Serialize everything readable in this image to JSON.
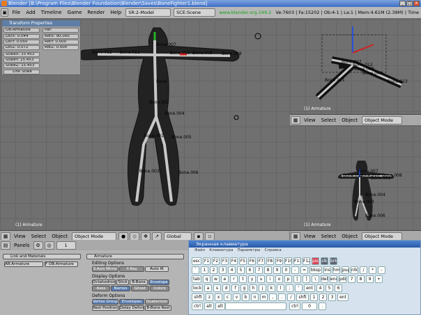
{
  "titlebar": {
    "title": "Blender [B:\\Program Files\\Blender Foundation\\Blender\\Saves\\BoneFighter1.blend]"
  },
  "menubar": {
    "menus": [
      "File",
      "Add",
      "Timeline",
      "Game",
      "Render",
      "Help"
    ],
    "screen": "SR:2-Model",
    "scene": "SCE:Scene",
    "website": "www.blender.org 249.2",
    "stats": "Ve:7603 | Fa:15202 | Ob:4-1 | La:1 | Mem:4.61M (2.39M) | Time"
  },
  "transform": {
    "title": "Transform Properties",
    "ob": "OB:Armature",
    "par": "Par:",
    "locx": "LocX: 0.044",
    "locy": "LocY: 0.050",
    "locz": "LocZ: 0.072",
    "rotx": "RotX: 90.000",
    "roty": "RotY: 0.000",
    "rotz": "RotZ: 0.000",
    "scalex": "ScaleX: 15.453",
    "scaley": "ScaleY: 15.453",
    "scalez": "ScaleZ: 15.453",
    "link": "Link Scale"
  },
  "main_view": {
    "label": "(1) Armature",
    "bones": [
      "Bone.007",
      "Bone.012",
      "Bone.011",
      "Bone.010",
      "Bone.009",
      "Bone.008",
      "Bone",
      "Bone.002",
      "Bone.004",
      "Bone.001",
      "Bone.005",
      "Bone.003",
      "Bone.006"
    ],
    "header": {
      "menus": [
        "View",
        "Select",
        "Object"
      ],
      "mode": "Object Mode",
      "orientation": "Global"
    }
  },
  "persp_view": {
    "label": "(1) Armature",
    "bones": [
      "Bone.007",
      "Bone.012",
      "Bone.008",
      "Bone.009",
      "Bone.013",
      "Bone.011"
    ],
    "header": {
      "menus": [
        "View",
        "Select",
        "Object"
      ],
      "mode": "Object Mode"
    }
  },
  "front_view": {
    "label": "(1) Armature",
    "bones": [
      "Bone.007",
      "Bone.012",
      "Bone.010",
      "Bone.008",
      "Bone.009",
      "Bone.004",
      "Bone.003",
      "Bone.006"
    ],
    "header": {
      "menus": [
        "View",
        "Select",
        "Object"
      ],
      "mode": "Object Mode"
    }
  },
  "buttons_window": {
    "panels_label": "Panels",
    "frame": "1",
    "link_tab": "Link and Materials",
    "armature_tab": "Armature",
    "ar_name": "AR:Armature",
    "ob_name": "F OB:Armature",
    "editing_options": "Editing Options",
    "x_axis_mirror": "X-Axis Mirror",
    "x_ray": "X-Ray",
    "auto_ik": "Auto IK",
    "display_options": "Display Options",
    "octahedron": "Octahedron",
    "stick": "Stick",
    "b_bone": "B-Bone",
    "envelope": "Envelope",
    "axes": "Axes",
    "names": "Names",
    "ghost": "Ghost",
    "colors": "Colors",
    "deform_options": "Deform Options",
    "vertex_groups": "Vertex Groups",
    "envelopes": "Envelopes",
    "quaternion": "Quaternion",
    "rest_position": "Rest Position",
    "delay_deform": "Delay Deform",
    "b_bone_rest": "B-Bone Rest"
  },
  "keyboard": {
    "title": "Экранная клавиатура",
    "menu": [
      "Файл",
      "Клавиатура",
      "Параметры",
      "Справка"
    ],
    "rows": [
      [
        "esc",
        "F1",
        "F2",
        "F3",
        "F4",
        "F5",
        "F6",
        "F7",
        "F8",
        "F9",
        "F10",
        "F11",
        "F12",
        "psc",
        "slk",
        "brk"
      ],
      [
        "`",
        "1",
        "2",
        "3",
        "4",
        "5",
        "6",
        "7",
        "8",
        "9",
        "0",
        "-",
        "=",
        "bksp",
        "ins",
        "hm",
        "pup",
        "nlk",
        "/",
        "*",
        "-"
      ],
      [
        "tab",
        "q",
        "w",
        "e",
        "r",
        "t",
        "y",
        "u",
        "i",
        "o",
        "p",
        "[",
        "]",
        "\\",
        "del",
        "end",
        "pdn",
        "7",
        "8",
        "9",
        "+"
      ],
      [
        "lock",
        "a",
        "s",
        "d",
        "f",
        "g",
        "h",
        "j",
        "k",
        "l",
        ";",
        "'",
        "ent",
        "4",
        "5",
        "6"
      ],
      [
        "shft",
        "z",
        "x",
        "c",
        "v",
        "b",
        "n",
        "m",
        ",",
        ".",
        "/",
        "shft",
        "1",
        "2",
        "3",
        "ent"
      ],
      [
        "ctrl",
        "alt",
        "alt",
        "ctrl",
        "0",
        "."
      ]
    ]
  }
}
